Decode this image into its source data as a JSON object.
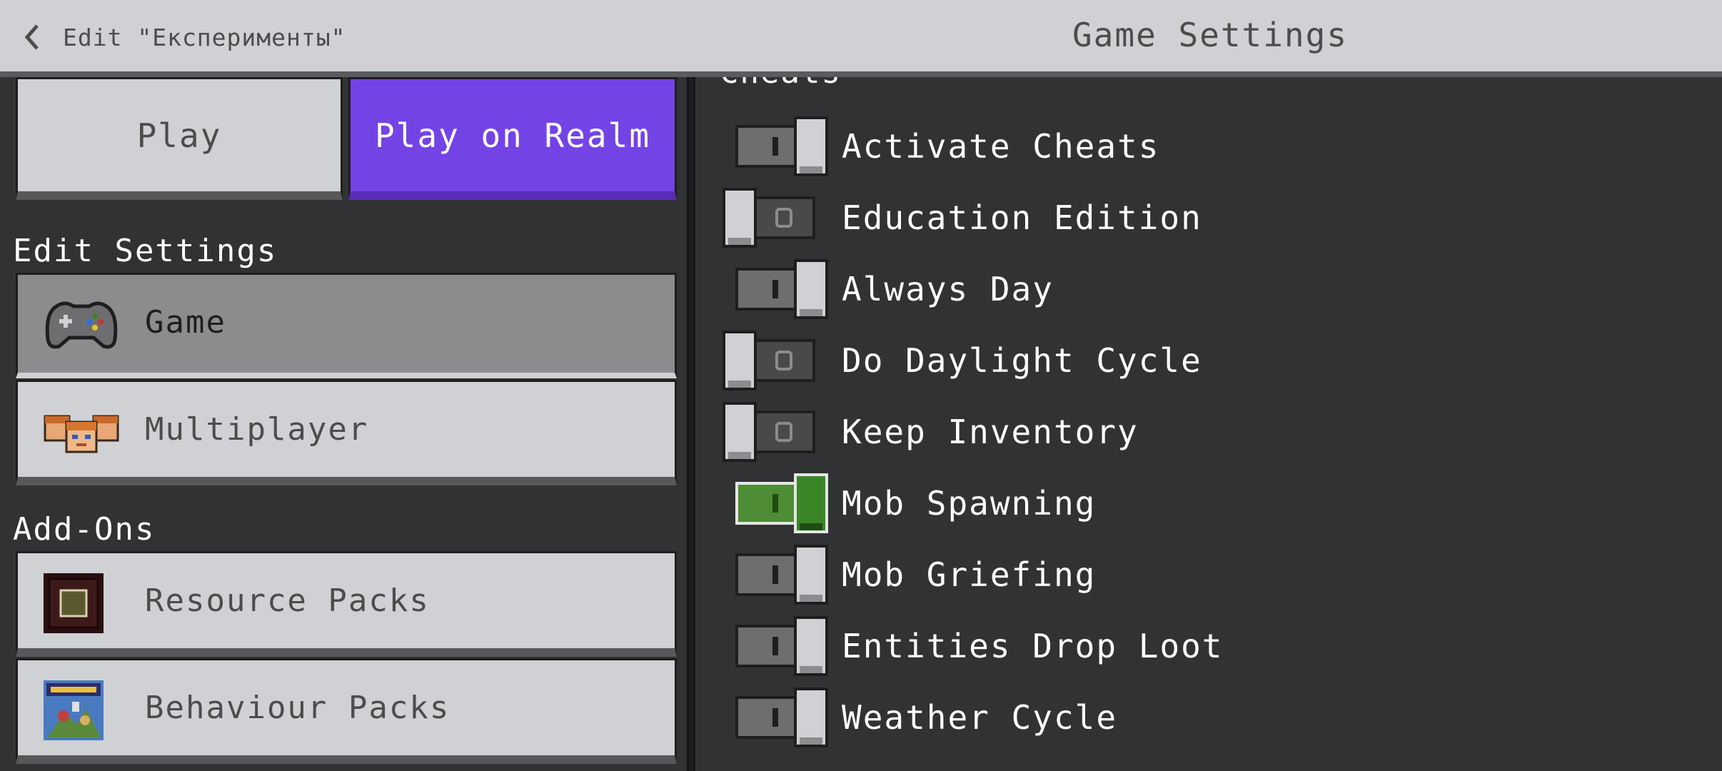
{
  "header": {
    "back_label": "Edit \"Експерименты\"",
    "title": "Game Settings"
  },
  "left": {
    "play_label": "Play",
    "realm_label": "Play on Realm",
    "edit_settings_heading": "Edit Settings",
    "nav": {
      "game": "Game",
      "multiplayer": "Multiplayer"
    },
    "addons_heading": "Add-Ons",
    "addons": {
      "resource_packs": "Resource Packs",
      "behaviour_packs": "Behaviour Packs"
    }
  },
  "right": {
    "section_heading": "Cheats",
    "toggles": [
      {
        "label": "Activate Cheats",
        "state": "on"
      },
      {
        "label": "Education Edition",
        "state": "off"
      },
      {
        "label": "Always Day",
        "state": "on"
      },
      {
        "label": "Do Daylight Cycle",
        "state": "off"
      },
      {
        "label": "Keep Inventory",
        "state": "off"
      },
      {
        "label": "Mob Spawning",
        "state": "on",
        "highlight": "green"
      },
      {
        "label": "Mob Griefing",
        "state": "on"
      },
      {
        "label": "Entities Drop Loot",
        "state": "on"
      },
      {
        "label": "Weather Cycle",
        "state": "on"
      }
    ]
  },
  "colors": {
    "background": "#313233",
    "header": "#d0d1d4",
    "realm_purple": "#7443e6",
    "toggle_green": "#3c8527"
  },
  "icons": {
    "back": "chevron-left-icon",
    "game": "controller-icon",
    "multiplayer": "players-faces-icon",
    "resource_packs": "resource-pack-icon",
    "behaviour_packs": "behaviour-pack-icon"
  }
}
